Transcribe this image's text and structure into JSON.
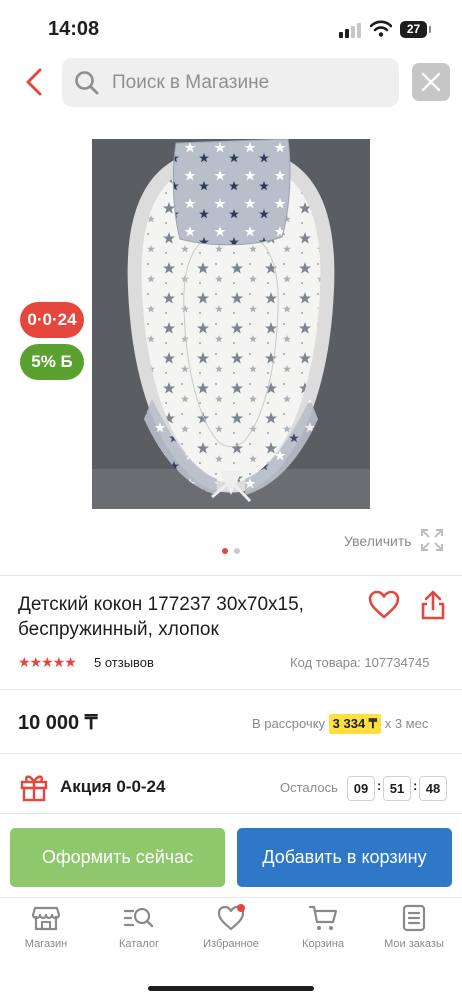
{
  "status_bar": {
    "time": "14:08",
    "battery": "27"
  },
  "search": {
    "placeholder": "Поиск в Магазине"
  },
  "badges": {
    "promo": "0·0·24",
    "bonus": "5% Б"
  },
  "gallery": {
    "zoom_label": "Увеличить",
    "dots_total": 2,
    "active_dot": 1
  },
  "product": {
    "title": "Детский кокон 177237 30х70х15, беспружинный, хлопок",
    "rating": 5,
    "stars": "★★★★★",
    "reviews": "5 отзывов",
    "sku": "Код товара: 107734745",
    "price": "10 000 ₸",
    "installment_prefix": "В рассрочку",
    "installment_amount": "3 334 ₸",
    "installment_suffix": "х 3 мес"
  },
  "promo": {
    "name": "Акция 0-0-24",
    "remaining_label": "Осталось",
    "timer": {
      "hours": "09",
      "minutes": "51",
      "seconds": "48"
    }
  },
  "actions": {
    "order": "Оформить сейчас",
    "add_to_cart": "Добавить в корзину"
  },
  "tab_bar": [
    {
      "label": "Магазин",
      "icon": "store-icon"
    },
    {
      "label": "Каталог",
      "icon": "catalog-search-icon"
    },
    {
      "label": "Избранное",
      "icon": "heart-icon"
    },
    {
      "label": "Корзина",
      "icon": "cart-icon"
    },
    {
      "label": "Мои заказы",
      "icon": "orders-icon"
    }
  ],
  "colors": {
    "accent_red": "#e5473d",
    "bonus_green": "#5ba130",
    "order_button": "#8fc76d",
    "cart_button": "#2e78c7",
    "installment_highlight": "#ffe040"
  }
}
